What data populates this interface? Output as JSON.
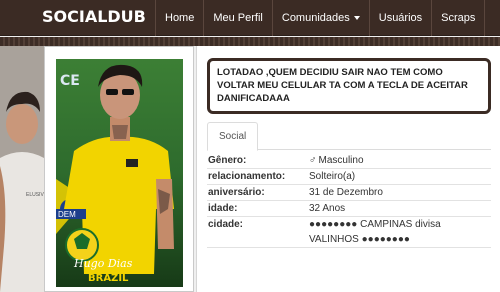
{
  "brand": "SOCIALDUB",
  "nav": {
    "items": [
      {
        "label": "Home"
      },
      {
        "label": "Meu Perfil"
      },
      {
        "label": "Comunidades"
      },
      {
        "label": "Usuários"
      },
      {
        "label": "Scraps"
      }
    ]
  },
  "profile": {
    "photo_caption_name": "Hugo Dias",
    "photo_caption_country": "BRAZIL",
    "photo_shirt_text": "DEM",
    "photo_logo_text": "CE"
  },
  "status": "LOTADAO ,QUEM DECIDIU SAIR NAO TEM COMO VOLTAR MEU CELULAR TA COM A TECLA DE ACEITAR DANIFICADAAA",
  "tabs": [
    {
      "label": "Social"
    }
  ],
  "social": {
    "gender_label": "Gênero:",
    "gender_symbol": "♂",
    "gender_value": "Masculino",
    "relationship_label": "relacionamento:",
    "relationship_value": "Solteiro(a)",
    "birthday_label": "aniversário:",
    "birthday_value": "31 de Dezembro",
    "age_label": "idade:",
    "age_value": "32 Anos",
    "city_label": "cidade:",
    "city_value": "●●●●●●●● CAMPINAS divisa VALINHOS ●●●●●●●●"
  },
  "colors": {
    "navbar": "#3b2b24",
    "status_border": "#3b2b24",
    "shirt_yellow": "#f2d400",
    "photo_green": "#2e6b2d"
  }
}
